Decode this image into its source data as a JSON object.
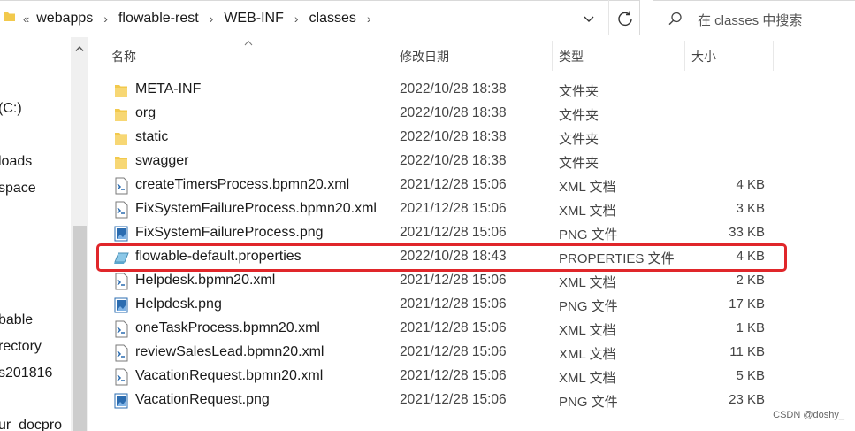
{
  "address_bar": {
    "crumbs": [
      "webapps",
      "flowable-rest",
      "WEB-INF",
      "classes"
    ],
    "overflow_glyph": "«"
  },
  "search": {
    "placeholder": "在 classes 中搜索"
  },
  "nav": {
    "items": [
      {
        "label": "(C:)"
      },
      {
        "label": "loads"
      },
      {
        "label": "space"
      },
      {
        "label": "bable"
      },
      {
        "label": "rectory"
      },
      {
        "label": "s201816"
      },
      {
        "label": "ur_docpro"
      }
    ]
  },
  "columns": {
    "name": "名称",
    "date": "修改日期",
    "type": "类型",
    "size": "大小"
  },
  "files": [
    {
      "name": "META-INF",
      "date": "2022/10/28 18:38",
      "type": "文件夹",
      "size": "",
      "icon": "folder-icon"
    },
    {
      "name": "org",
      "date": "2022/10/28 18:38",
      "type": "文件夹",
      "size": "",
      "icon": "folder-icon"
    },
    {
      "name": "static",
      "date": "2022/10/28 18:38",
      "type": "文件夹",
      "size": "",
      "icon": "folder-icon"
    },
    {
      "name": "swagger",
      "date": "2022/10/28 18:38",
      "type": "文件夹",
      "size": "",
      "icon": "folder-icon"
    },
    {
      "name": "createTimersProcess.bpmn20.xml",
      "date": "2021/12/28 15:06",
      "type": "XML 文档",
      "size": "4 KB",
      "icon": "xml-file-icon"
    },
    {
      "name": "FixSystemFailureProcess.bpmn20.xml",
      "date": "2021/12/28 15:06",
      "type": "XML 文档",
      "size": "3 KB",
      "icon": "xml-file-icon"
    },
    {
      "name": "FixSystemFailureProcess.png",
      "date": "2021/12/28 15:06",
      "type": "PNG 文件",
      "size": "33 KB",
      "icon": "image-file-icon"
    },
    {
      "name": "flowable-default.properties",
      "date": "2022/10/28 18:43",
      "type": "PROPERTIES 文件",
      "size": "4 KB",
      "icon": "properties-file-icon"
    },
    {
      "name": "Helpdesk.bpmn20.xml",
      "date": "2021/12/28 15:06",
      "type": "XML 文档",
      "size": "2 KB",
      "icon": "xml-file-icon"
    },
    {
      "name": "Helpdesk.png",
      "date": "2021/12/28 15:06",
      "type": "PNG 文件",
      "size": "17 KB",
      "icon": "image-file-icon"
    },
    {
      "name": "oneTaskProcess.bpmn20.xml",
      "date": "2021/12/28 15:06",
      "type": "XML 文档",
      "size": "1 KB",
      "icon": "xml-file-icon"
    },
    {
      "name": "reviewSalesLead.bpmn20.xml",
      "date": "2021/12/28 15:06",
      "type": "XML 文档",
      "size": "11 KB",
      "icon": "xml-file-icon"
    },
    {
      "name": "VacationRequest.bpmn20.xml",
      "date": "2021/12/28 15:06",
      "type": "XML 文档",
      "size": "5 KB",
      "icon": "xml-file-icon"
    },
    {
      "name": "VacationRequest.png",
      "date": "2021/12/28 15:06",
      "type": "PNG 文件",
      "size": "23 KB",
      "icon": "image-file-icon"
    }
  ],
  "highlighted_file": "flowable-default.properties",
  "colors": {
    "highlight": "#e0262a",
    "folder": "#f2c94c"
  },
  "watermark": "CSDN @doshy_"
}
